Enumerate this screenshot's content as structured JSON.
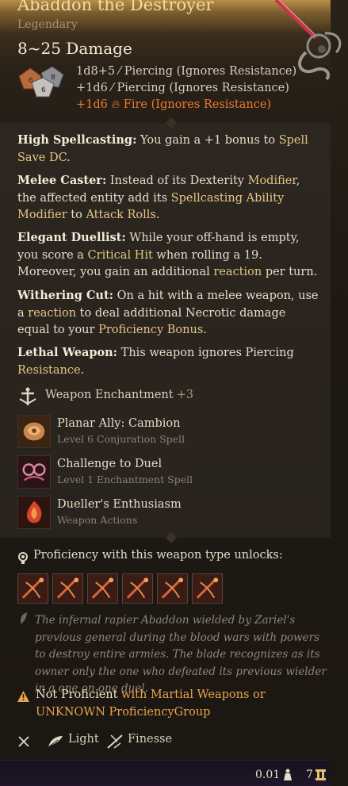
{
  "item": {
    "title": "Abaddon the Destroyer",
    "rarity": "Legendary",
    "damage": "8~25 Damage",
    "damage_lines": [
      {
        "dice": "1d8+5",
        "type": "Piercing (Ignores Resistance)"
      },
      {
        "dice": "+1d6",
        "type": "Piercing (Ignores Resistance)"
      },
      {
        "dice": "+1d6",
        "type": "Fire (Ignores Resistance)"
      }
    ],
    "dice_faces": [
      "6",
      "8",
      "6"
    ]
  },
  "passives": [
    {
      "name": "High Spellcasting:",
      "parts": [
        {
          "t": " You gain a +1 bonus to "
        },
        {
          "k": "Spell Save"
        },
        {
          "t": " "
        },
        {
          "k": "DC"
        },
        {
          "t": "."
        }
      ]
    },
    {
      "name": "Melee Caster:",
      "parts": [
        {
          "t": " Instead of its Dexterity "
        },
        {
          "k": "Modifier"
        },
        {
          "t": ", the affected entity add its "
        },
        {
          "k": "Spellcasting Ability Modifier"
        },
        {
          "t": " to "
        },
        {
          "k": "Attack Rolls"
        },
        {
          "t": "."
        }
      ]
    },
    {
      "name": "Elegant Duellist:",
      "parts": [
        {
          "t": " While your off-hand is empty, you score a "
        },
        {
          "k": "Critical Hit"
        },
        {
          "t": " when rolling a 19. Moreover, you gain an additional "
        },
        {
          "k": "reaction"
        },
        {
          "t": " per turn."
        }
      ]
    },
    {
      "name": "Withering Cut:",
      "parts": [
        {
          "t": " On a hit with a melee weapon, use a "
        },
        {
          "k": "reaction"
        },
        {
          "t": " to deal additional Necrotic damage equal to your "
        },
        {
          "k": "Proficiency Bonus"
        },
        {
          "t": "."
        }
      ]
    },
    {
      "name": "Lethal Weapon:",
      "parts": [
        {
          "t": " This weapon ignores Piercing "
        },
        {
          "k": "Resistance"
        },
        {
          "t": "."
        }
      ]
    }
  ],
  "enchantment": {
    "label": "Weapon Enchantment",
    "value": "+3",
    "icon": "enchantment-icon"
  },
  "spells": [
    {
      "name": "Planar Ally: Cambion",
      "sub": "Level 6 Conjuration Spell",
      "icon": "cambion-icon"
    },
    {
      "name": "Challenge to Duel",
      "sub": "Level 1 Enchantment Spell",
      "icon": "duel-icon"
    },
    {
      "name": "Dueller's Enthusiasm",
      "sub": "Weapon Actions",
      "icon": "enthusiasm-icon"
    }
  ],
  "proficiency": {
    "label": "Proficiency with this weapon type unlocks:",
    "action_count": 6
  },
  "lore": "The infernal rapier Abaddon wielded by Zariel's previous general during the blood wars with powers to destroy entire armies. The blade recognizes as its owner only the one who defeated its previous wielder in a one on one duel.",
  "warning": {
    "not_proficient": "Not Proficient",
    "rest": " with Martial Weapons or UNKNOWN ProficiencyGroup"
  },
  "properties": [
    {
      "label": "Light",
      "icon": "feather-icon"
    },
    {
      "label": "Finesse",
      "icon": "finesse-icon"
    }
  ],
  "footer": {
    "weight": "0.01",
    "value": "7"
  },
  "colors": {
    "keyword": "#e4c785",
    "fire": "#f07a2c",
    "warning": "#e9a54a",
    "title": "#f0dca8"
  }
}
